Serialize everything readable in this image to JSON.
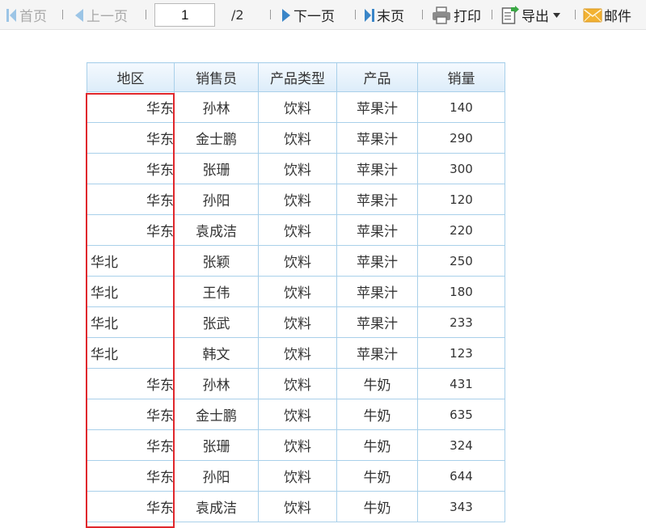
{
  "toolbar": {
    "first_label": "首页",
    "prev_label": "上一页",
    "page_value": "1",
    "page_total": "/2",
    "next_label": "下一页",
    "last_label": "末页",
    "print_label": "打印",
    "export_label": "导出",
    "mail_label": "邮件"
  },
  "table": {
    "headers": [
      "地区",
      "销售员",
      "产品类型",
      "产品",
      "销量"
    ],
    "rows": [
      {
        "region": "华东",
        "align": "right",
        "seller": "孙林",
        "type": "饮料",
        "product": "苹果汁",
        "qty": "140"
      },
      {
        "region": "华东",
        "align": "right",
        "seller": "金士鹏",
        "type": "饮料",
        "product": "苹果汁",
        "qty": "290"
      },
      {
        "region": "华东",
        "align": "right",
        "seller": "张珊",
        "type": "饮料",
        "product": "苹果汁",
        "qty": "300"
      },
      {
        "region": "华东",
        "align": "right",
        "seller": "孙阳",
        "type": "饮料",
        "product": "苹果汁",
        "qty": "120"
      },
      {
        "region": "华东",
        "align": "right",
        "seller": "袁成洁",
        "type": "饮料",
        "product": "苹果汁",
        "qty": "220"
      },
      {
        "region": "华北",
        "align": "left",
        "seller": "张颖",
        "type": "饮料",
        "product": "苹果汁",
        "qty": "250"
      },
      {
        "region": "华北",
        "align": "left",
        "seller": "王伟",
        "type": "饮料",
        "product": "苹果汁",
        "qty": "180"
      },
      {
        "region": "华北",
        "align": "left",
        "seller": "张武",
        "type": "饮料",
        "product": "苹果汁",
        "qty": "233"
      },
      {
        "region": "华北",
        "align": "left",
        "seller": "韩文",
        "type": "饮料",
        "product": "苹果汁",
        "qty": "123"
      },
      {
        "region": "华东",
        "align": "right",
        "seller": "孙林",
        "type": "饮料",
        "product": "牛奶",
        "qty": "431"
      },
      {
        "region": "华东",
        "align": "right",
        "seller": "金士鹏",
        "type": "饮料",
        "product": "牛奶",
        "qty": "635"
      },
      {
        "region": "华东",
        "align": "right",
        "seller": "张珊",
        "type": "饮料",
        "product": "牛奶",
        "qty": "324"
      },
      {
        "region": "华东",
        "align": "right",
        "seller": "孙阳",
        "type": "饮料",
        "product": "牛奶",
        "qty": "644"
      },
      {
        "region": "华东",
        "align": "right",
        "seller": "袁成洁",
        "type": "饮料",
        "product": "牛奶",
        "qty": "343"
      }
    ]
  },
  "colors": {
    "accent_blue": "#3a86c8",
    "disabled_gray": "#a8a8a8",
    "highlight_red": "#e0272c",
    "grid_blue": "#a9d0ea",
    "mail_orange": "#f2b233",
    "export_green": "#3aa844"
  },
  "icons": {
    "first": "skip-first-icon",
    "prev": "triangle-left-icon",
    "next": "triangle-right-icon",
    "last": "skip-last-icon",
    "print": "printer-icon",
    "export": "export-document-icon",
    "export_menu": "caret-down-icon",
    "mail": "envelope-icon"
  }
}
